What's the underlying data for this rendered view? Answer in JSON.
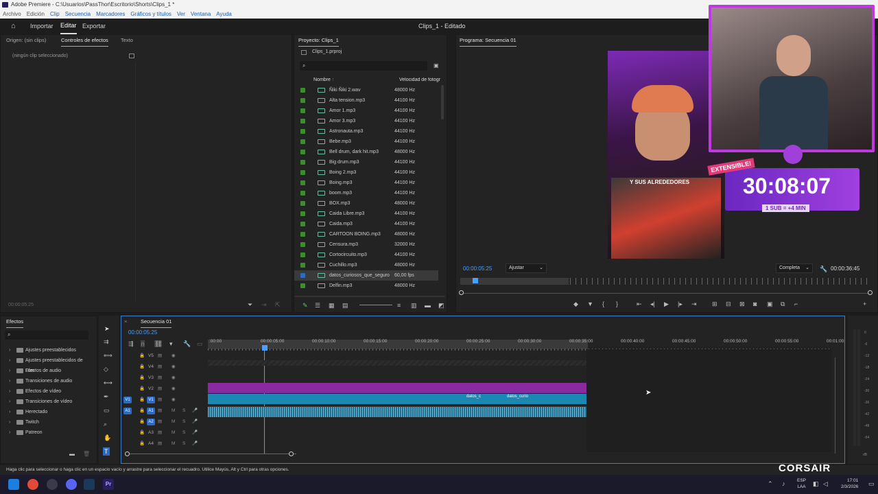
{
  "window": {
    "title": "Adobe Premiere - C:\\Usuarios\\PassThor\\Escritorio\\Shorts\\Clips_1 *"
  },
  "menu": [
    "Archivo",
    "Edición",
    "Clip",
    "Secuencia",
    "Marcadores",
    "Gráficos y títulos",
    "Ver",
    "Ventana",
    "Ayuda"
  ],
  "header": {
    "import": "Importar",
    "edit": "Editar",
    "export": "Exportar",
    "doc_title": "Clips_1 - Editado"
  },
  "source_panel": {
    "tab_origin": "Origen: (sin clips)",
    "tab_effect_controls": "Controles de efectos",
    "tab_text": "Texto",
    "empty_msg": "(ningún clip seleccionado)",
    "timecode": "00:00:05:25"
  },
  "project_panel": {
    "tab": "Proyecto: Clips_1",
    "file": "Clips_1.prproj",
    "col_name": "Nombre",
    "col_rate": "Velocidad de fotogr",
    "items": [
      {
        "name": "Ñiki Ñiki 2.wav",
        "rate": "48000 Hz"
      },
      {
        "name": "Alta tension.mp3",
        "rate": "44100 Hz"
      },
      {
        "name": "Amor 1.mp3",
        "rate": "44100 Hz"
      },
      {
        "name": "Amor 3.mp3",
        "rate": "44100 Hz"
      },
      {
        "name": "Astronauta.mp3",
        "rate": "44100 Hz"
      },
      {
        "name": "Bebe.mp3",
        "rate": "44100 Hz"
      },
      {
        "name": "Bell drum, dark hit.mp3",
        "rate": "48000 Hz"
      },
      {
        "name": "Big drum.mp3",
        "rate": "44100 Hz"
      },
      {
        "name": "Boing 2.mp3",
        "rate": "44100 Hz"
      },
      {
        "name": "Boing.mp3",
        "rate": "44100 Hz"
      },
      {
        "name": "boom.mp3",
        "rate": "44100 Hz"
      },
      {
        "name": "BOX.mp3",
        "rate": "48000 Hz"
      },
      {
        "name": "Caida Libre.mp3",
        "rate": "44100 Hz"
      },
      {
        "name": "Caida.mp3",
        "rate": "44100 Hz"
      },
      {
        "name": "CARTOON BOING.mp3",
        "rate": "48000 Hz"
      },
      {
        "name": "Censura.mp3",
        "rate": "32000 Hz"
      },
      {
        "name": "Cortocircuito.mp3",
        "rate": "44100 Hz"
      },
      {
        "name": "Cuchillo.mp3",
        "rate": "48000 Hz"
      },
      {
        "name": "datos_curiosos_que_seguro",
        "rate": "60,00 fps"
      },
      {
        "name": "Delfin.mp3",
        "rate": "48000 Hz"
      }
    ]
  },
  "program_panel": {
    "tab": "Programa: Secuencia 01",
    "timecode": "00:00:05:25",
    "fit": "Ajustar",
    "quality": "Completa",
    "duration": "00:00:36:45"
  },
  "overlay": {
    "caption": "Y SUS ALREDEDORES",
    "extensible": "EXTENSIBLE!",
    "timer": "30:08:07",
    "sub_rule": "1 SUB = +4 MIN",
    "brand": "CORSAIR"
  },
  "effects_panel": {
    "tab": "Efectos",
    "items": [
      "Ajustes preestablecidos",
      "Ajustes preestablecidos de Lum",
      "Efectos de audio",
      "Transiciones de audio",
      "Efectos de vídeo",
      "Transiciones de vídeo",
      "Herectado",
      "Twitch",
      "Patreon"
    ]
  },
  "timeline": {
    "tab": "Secuencia 01",
    "timecode": "00:00:05:25",
    "ruler": [
      ":00:00",
      "00:00:05:00",
      "00:00:10:00",
      "00:00:15:00",
      "00:00:20:00",
      "00:00:25:00",
      "00:00:30:00",
      "00:00:35:00",
      "00:00:40:00",
      "00:00:45:00",
      "00:00:50:00",
      "00:00:55:00",
      "00:01:00:"
    ],
    "video_tracks": [
      "V5",
      "V4",
      "V3",
      "V2",
      "V1"
    ],
    "audio_tracks": [
      "A1",
      "A2",
      "A3",
      "A4"
    ],
    "clip_labels": [
      "datos_c",
      "datos_curio"
    ],
    "meter_ticks": [
      "0",
      "-6",
      "-12",
      "-18",
      "-24",
      "-30",
      "-36",
      "-42",
      "-48",
      "-54"
    ],
    "meter_unit": "dB"
  },
  "status_bar": "Haga clic para seleccionar o haga clic en un espacio vacío y arrastre para seleccionar el recuadro. Utilice Mayús, Alt y Ctrl para otras opciones.",
  "tray": {
    "lang1": "ESP",
    "lang2": "LAA",
    "time": "17:01",
    "date": "2/3/2026"
  }
}
